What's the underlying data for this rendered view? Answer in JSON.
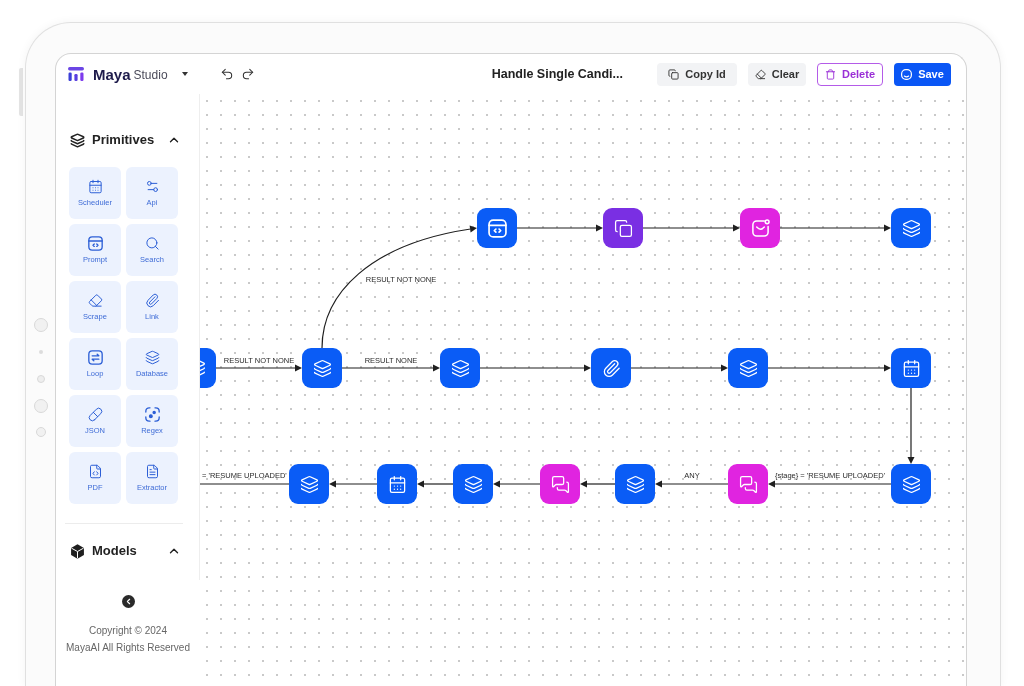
{
  "header": {
    "logo": {
      "name": "Maya",
      "suffix": "Studio"
    },
    "title": "Handle Single Candi...",
    "buttons": [
      {
        "label": "Copy Id",
        "kind": "secondary"
      },
      {
        "label": "Clear",
        "kind": "secondary"
      },
      {
        "label": "Delete",
        "kind": "danger"
      },
      {
        "label": "Save",
        "kind": "primary"
      }
    ]
  },
  "sidebar": {
    "sections": [
      {
        "title": "Primitives",
        "expanded": true,
        "items": [
          {
            "label": "Scheduler"
          },
          {
            "label": "Api"
          },
          {
            "label": "Prompt"
          },
          {
            "label": "Search"
          },
          {
            "label": "Scrape"
          },
          {
            "label": "Link"
          },
          {
            "label": "Loop"
          },
          {
            "label": "Database"
          },
          {
            "label": "JSON"
          },
          {
            "label": "Regex"
          },
          {
            "label": "PDF"
          },
          {
            "label": "Extractor"
          }
        ]
      },
      {
        "title": "Models",
        "expanded": true
      }
    ],
    "footer": [
      "Copyright © 2024",
      "MayaAI All Rights Reserved"
    ]
  },
  "canvas": {
    "nodes": [
      {
        "kind": "prompt",
        "color": "#0a5cf6"
      },
      {
        "kind": "model",
        "color": "#7a2fe3"
      },
      {
        "kind": "email",
        "color": "#e024e0"
      },
      {
        "kind": "database",
        "color": "#0a5cf6"
      },
      {
        "kind": "database",
        "color": "#0a5cf6"
      },
      {
        "kind": "database",
        "color": "#0a5cf6"
      },
      {
        "kind": "database",
        "color": "#0a5cf6"
      },
      {
        "kind": "link",
        "color": "#0a5cf6"
      },
      {
        "kind": "database",
        "color": "#0a5cf6"
      },
      {
        "kind": "scheduler",
        "color": "#0a5cf6"
      },
      {
        "kind": "database",
        "color": "#0a5cf6"
      },
      {
        "kind": "scheduler",
        "color": "#0a5cf6"
      },
      {
        "kind": "database",
        "color": "#0a5cf6"
      },
      {
        "kind": "chat",
        "color": "#e024e0"
      },
      {
        "kind": "database",
        "color": "#0a5cf6"
      },
      {
        "kind": "chat",
        "color": "#e024e0"
      },
      {
        "kind": "database",
        "color": "#0a5cf6"
      }
    ],
    "edge_labels": [
      "RESULT NOT NONE",
      "RESULT NOT NONE",
      "RESULT NONE",
      "= 'RESUME UPLOADED'",
      "ANY",
      "{stage} = 'RESUME UPLOADED'"
    ]
  }
}
